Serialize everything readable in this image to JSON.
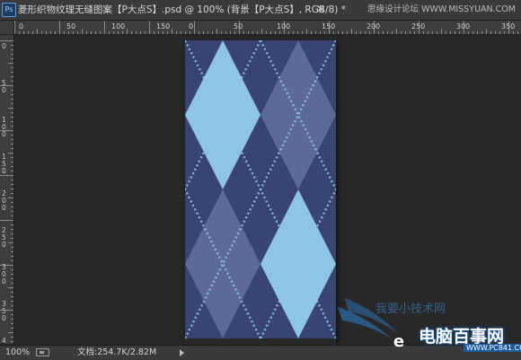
{
  "window": {
    "app_badge": "Ps",
    "doc_title": "菱形织物纹理无缝图案【P大点S】.psd @ 100% (背景【P大点S】, RGB/8) *",
    "close_label": "×",
    "watermark_site": "思缘设计论坛  WWW.MISSYUAN.COM"
  },
  "rulers": {
    "horizontal_ticks": [
      "0",
      "50",
      "100",
      "150",
      "200",
      "250",
      "0",
      "50",
      "100",
      "150",
      "200",
      "250",
      "300",
      "350",
      "400"
    ],
    "vertical_ticks": [
      "0",
      "50",
      "100",
      "150",
      "200",
      "250",
      "300",
      "350",
      "400"
    ]
  },
  "canvas": {
    "background_color": "#282828",
    "pattern_colors": {
      "base": "#3a4470",
      "light_diamond": "#8ec5e4",
      "mid_diamond": "#5d6a95",
      "stitch": "#8ec5e4"
    }
  },
  "status": {
    "zoom": "100%",
    "doc_info": "文档:254.7K/2.82M"
  },
  "watermark": {
    "logo_text": "e",
    "site_name": "电脑百事网",
    "site_url": "WWW.PC841.COM",
    "faint_text": "我要小技术网"
  }
}
